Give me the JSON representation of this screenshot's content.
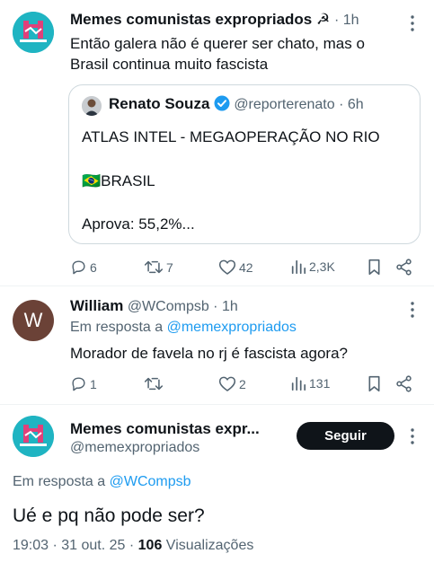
{
  "tweet1": {
    "author_name": "Memes comunistas expropriados ☭",
    "time": "· 1h",
    "text_line1": "Então galera não é querer ser chato, mas o",
    "text_line2": "Brasil continua muito fascista",
    "quote": {
      "author_name": "Renato Souza",
      "handle_time": "@reporterenato · 6h",
      "line1": "ATLAS INTEL - MEGAOPERAÇÃO NO RIO",
      "line2": "🇧🇷BRASIL",
      "line3": "Aprova: 55,2%..."
    },
    "replies": "6",
    "retweets": "7",
    "likes": "42",
    "views": "2,3K"
  },
  "tweet2": {
    "avatar_letter": "W",
    "author_name": "William",
    "handle_time": "@WCompsb · 1h",
    "reply_prefix": "Em resposta a ",
    "reply_to": "@memexpropriados",
    "text": "Morador de favela no rj é fascista agora?",
    "replies": "1",
    "retweets": "",
    "likes": "2",
    "views": "131"
  },
  "main_tweet": {
    "author_name": "Memes comunistas expr...",
    "handle": "@memexpropriados",
    "follow_label": "Seguir",
    "reply_prefix": "Em resposta a ",
    "reply_to": "@WCompsb",
    "text": "Ué e pq não pode ser?",
    "timestamp": "19:03 · 31 out. 25 · ",
    "view_count": "106",
    "views_label": " Visualizações"
  },
  "colors": {
    "accent": "#1d9bf0",
    "logo_bg": "#1fb4c2",
    "logo_fg": "#e0407a",
    "text": "#0f1419",
    "muted": "#536471"
  },
  "icons": [
    "more-icon",
    "verified-icon",
    "reply-icon",
    "retweet-icon",
    "like-icon",
    "views-icon",
    "bookmark-icon",
    "share-icon"
  ]
}
